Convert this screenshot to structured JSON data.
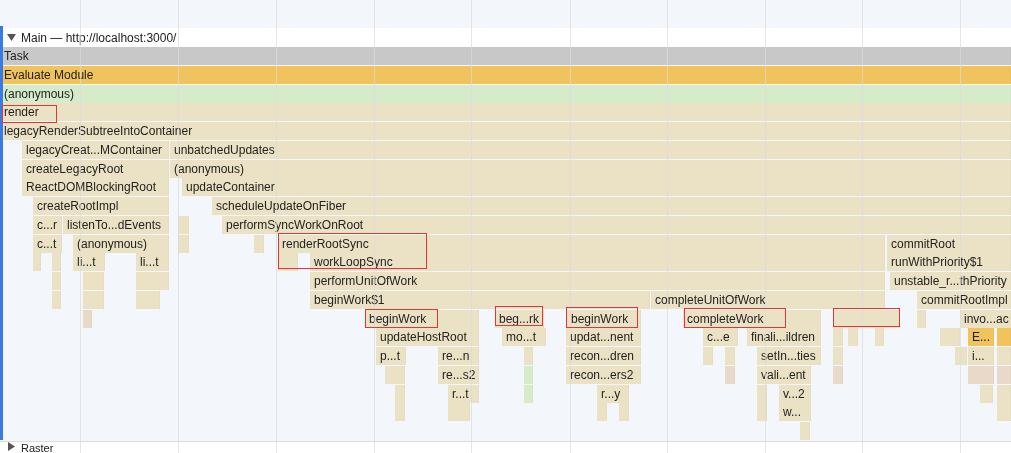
{
  "track": {
    "title": "Main — http://localhost:3000/",
    "expanded": true
  },
  "bars": [
    {
      "label": "Task",
      "color": "#c8c8c8"
    },
    {
      "label": "Evaluate Module",
      "color": "#f0c35c"
    },
    {
      "label": "(anonymous)",
      "color": "#d5ebca"
    },
    {
      "label": "render",
      "color": "#ebe2c5"
    },
    {
      "label": "legacyRenderSubtreeIntoContainer",
      "color": "#ebe2c5"
    },
    {
      "label": "legacyCreat...MContainer",
      "color": "#ebe2c5"
    },
    {
      "label": "unbatchedUpdates",
      "color": "#ebe2c5"
    },
    {
      "label": "createLegacyRoot",
      "color": "#ebe2c5"
    },
    {
      "label": "(anonymous)",
      "color": "#ebe2c5"
    },
    {
      "label": "ReactDOMBlockingRoot",
      "color": "#ebe2c5"
    },
    {
      "label": "updateContainer",
      "color": "#ebe2c5"
    },
    {
      "label": "createRootImpl",
      "color": "#ebe2c5"
    },
    {
      "label": "scheduleUpdateOnFiber",
      "color": "#ebe2c5"
    },
    {
      "label": "c...r",
      "color": "#ebe2c5"
    },
    {
      "label": "listenTo...dEvents",
      "color": "#ebe2c5"
    },
    {
      "label": "performSyncWorkOnRoot",
      "color": "#ebe2c5"
    },
    {
      "label": "c...t",
      "color": "#ebe2c5"
    },
    {
      "label": "(anonymous)",
      "color": "#ebe2c5"
    },
    {
      "label": "renderRootSync",
      "color": "#ebe2c5"
    },
    {
      "label": "commitRoot",
      "color": "#ebe2c5"
    },
    {
      "label": "li...t",
      "color": "#ebe2c5"
    },
    {
      "label": "li...t",
      "color": "#ebe2c5"
    },
    {
      "label": "workLoopSync",
      "color": "#ebe2c5"
    },
    {
      "label": "runWithPriority$1",
      "color": "#ebe2c5"
    },
    {
      "label": "performUnitOfWork",
      "color": "#ebe2c5"
    },
    {
      "label": "unstable_r...thPriority",
      "color": "#ebe2c5"
    },
    {
      "label": "beginWork$1",
      "color": "#ebe2c5"
    },
    {
      "label": "completeUnitOfWork",
      "color": "#ebe2c5"
    },
    {
      "label": "commitRootImpl",
      "color": "#ebe2c5"
    },
    {
      "label": "beginWork",
      "color": "#ebe2c5"
    },
    {
      "label": "beg...rk",
      "color": "#ebe2c5"
    },
    {
      "label": "beginWork",
      "color": "#ebe2c5"
    },
    {
      "label": "completeWork",
      "color": "#ebe2c5"
    },
    {
      "label": "invo...ac",
      "color": "#ebe2c5"
    },
    {
      "label": "updateHostRoot",
      "color": "#ebe2c5"
    },
    {
      "label": "mo...t",
      "color": "#ebe2c5"
    },
    {
      "label": "updat...nent",
      "color": "#ebe2c5"
    },
    {
      "label": "c...e",
      "color": "#ebe2c5"
    },
    {
      "label": "finali...ildren",
      "color": "#ebe2c5"
    },
    {
      "label": "E...",
      "color": "#f0c35c"
    },
    {
      "label": "p...t",
      "color": "#ebe2c5"
    },
    {
      "label": "re...n",
      "color": "#ebe2c5"
    },
    {
      "label": "recon...dren",
      "color": "#ebe2c5"
    },
    {
      "label": "setIn...ties",
      "color": "#ebe2c5"
    },
    {
      "label": "i...",
      "color": "#ebe2c5"
    },
    {
      "label": "re...s2",
      "color": "#ebe2c5"
    },
    {
      "label": "recon...ers2",
      "color": "#ebe2c5"
    },
    {
      "label": "vali...ent",
      "color": "#ebe2c5"
    },
    {
      "label": "r...t",
      "color": "#ebe2c5"
    },
    {
      "label": "r...y",
      "color": "#ebe2c5"
    },
    {
      "label": "v...2",
      "color": "#ebe2c5"
    },
    {
      "label": "w...",
      "color": "#ebe2c5"
    }
  ],
  "next_track": {
    "title": "Raster",
    "expanded": false
  }
}
